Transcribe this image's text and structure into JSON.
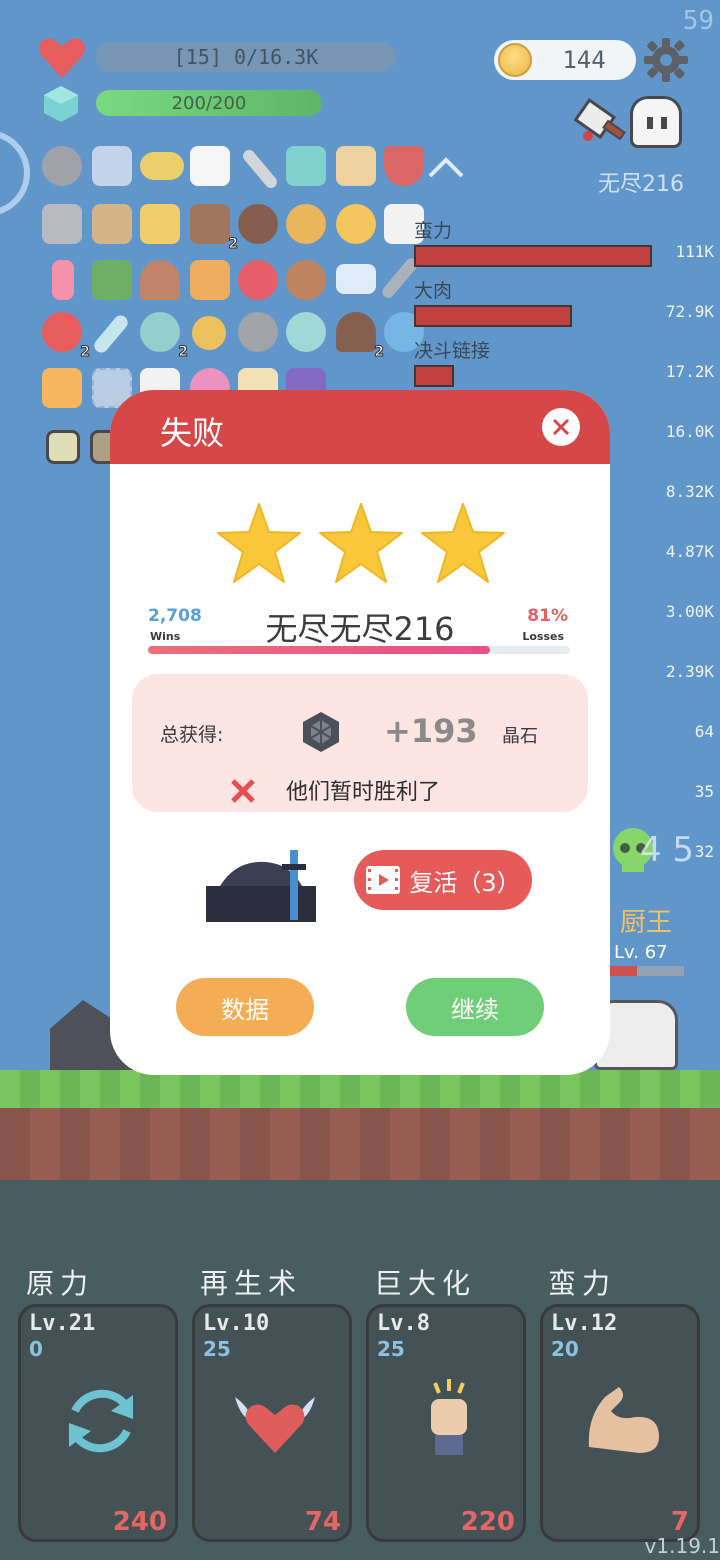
{
  "hud": {
    "fps": "59",
    "hp_text": "[15] 0/16.3K",
    "mana_text": "200/200",
    "coins": "144",
    "mode_label": "无尽216"
  },
  "damage_stats": [
    {
      "name": "蛮力",
      "value": "111K",
      "fraction": 0.78
    },
    {
      "name": "大肉",
      "value": "72.9K",
      "fraction": 0.51
    },
    {
      "name": "决斗链接",
      "value": "17.2K",
      "fraction": 0.13
    },
    {
      "name": "",
      "value": "16.0K"
    },
    {
      "name": "",
      "value": "8.32K"
    },
    {
      "name": "",
      "value": "4.87K"
    },
    {
      "name": "",
      "value": "3.00K"
    },
    {
      "name": "",
      "value": "2.39K"
    },
    {
      "name": "",
      "value": "64"
    },
    {
      "name": "",
      "value": "35"
    },
    {
      "name": "",
      "value": "32"
    }
  ],
  "item_badges": {
    "badge_value": "2"
  },
  "enemy": {
    "count": "4 5",
    "name": "厨王",
    "level": "Lv. 67"
  },
  "modal": {
    "title": "失败",
    "stars": 3,
    "wins_value": "2,708",
    "wins_label": "Wins",
    "level_name": "无尽无尽216",
    "losses_value": "81%",
    "losses_label": "Losses",
    "loss_fraction": 0.81,
    "reward_label": "总获得:",
    "reward_amount": "+193",
    "reward_unit": "晶石",
    "status_message": "他们暂时胜利了",
    "revive_label": "复活（3）",
    "data_button": "数据",
    "continue_button": "继续"
  },
  "skills": [
    {
      "name": "原力",
      "level": "Lv.21",
      "value": "0",
      "cost": "240",
      "icon": "refresh-icon"
    },
    {
      "name": "再生术",
      "level": "Lv.10",
      "value": "25",
      "cost": "74",
      "icon": "winged-heart-icon"
    },
    {
      "name": "巨大化",
      "level": "Lv.8",
      "value": "25",
      "cost": "220",
      "icon": "fist-icon"
    },
    {
      "name": "蛮力",
      "level": "Lv.12",
      "value": "20",
      "cost": "7",
      "icon": "muscle-arm-icon"
    }
  ],
  "version": "v1.19.1",
  "colors": {
    "header_red": "#d64848",
    "revive_red": "#e65a5a",
    "data_orange": "#f5ad55",
    "continue_green": "#6fcf78",
    "star_yellow": "#f9c73a",
    "wins_blue": "#5aa0d8",
    "loss_red": "#e56060"
  }
}
